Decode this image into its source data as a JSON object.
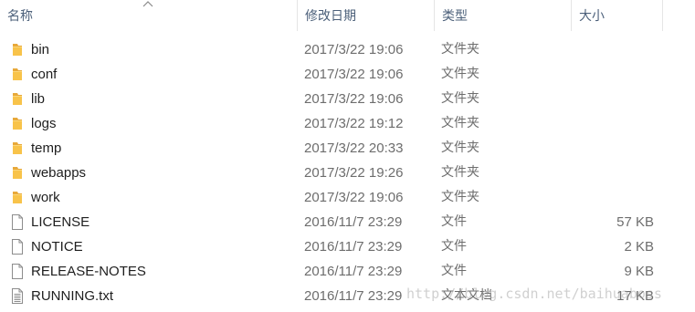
{
  "columns": {
    "name": "名称",
    "date": "修改日期",
    "type": "类型",
    "size": "大小"
  },
  "files": [
    {
      "name": "bin",
      "date": "2017/3/22 19:06",
      "type": "文件夹",
      "size": "",
      "icon": "folder-icon"
    },
    {
      "name": "conf",
      "date": "2017/3/22 19:06",
      "type": "文件夹",
      "size": "",
      "icon": "folder-icon"
    },
    {
      "name": "lib",
      "date": "2017/3/22 19:06",
      "type": "文件夹",
      "size": "",
      "icon": "folder-icon"
    },
    {
      "name": "logs",
      "date": "2017/3/22 19:12",
      "type": "文件夹",
      "size": "",
      "icon": "folder-icon"
    },
    {
      "name": "temp",
      "date": "2017/3/22 20:33",
      "type": "文件夹",
      "size": "",
      "icon": "folder-icon"
    },
    {
      "name": "webapps",
      "date": "2017/3/22 19:26",
      "type": "文件夹",
      "size": "",
      "icon": "folder-icon"
    },
    {
      "name": "work",
      "date": "2017/3/22 19:06",
      "type": "文件夹",
      "size": "",
      "icon": "folder-icon"
    },
    {
      "name": "LICENSE",
      "date": "2016/11/7 23:29",
      "type": "文件",
      "size": "57 KB",
      "icon": "file-icon"
    },
    {
      "name": "NOTICE",
      "date": "2016/11/7 23:29",
      "type": "文件",
      "size": "2 KB",
      "icon": "file-icon"
    },
    {
      "name": "RELEASE-NOTES",
      "date": "2016/11/7 23:29",
      "type": "文件",
      "size": "9 KB",
      "icon": "file-icon"
    },
    {
      "name": "RUNNING.txt",
      "date": "2016/11/7 23:29",
      "type": "文本文档",
      "size": "17 KB",
      "icon": "text-file-icon"
    }
  ],
  "watermark": "http://blog.csdn.net/baihuaboss",
  "colors": {
    "folder": "#f8c34a",
    "header_text": "#4c607a"
  }
}
